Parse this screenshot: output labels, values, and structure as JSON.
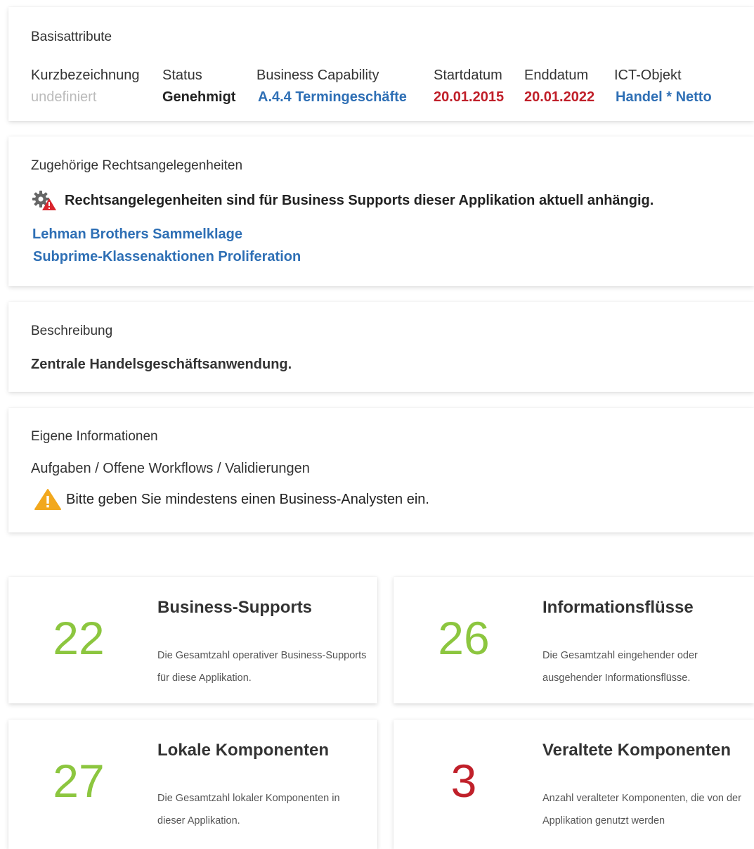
{
  "colors": {
    "link": "#2e6fb5",
    "date": "#c0202a",
    "count_green": "#8cc63f",
    "count_red": "#c0202a",
    "muted": "#bbbbbb"
  },
  "basis": {
    "title": "Basisattribute",
    "columns": [
      {
        "label": "Kurzbezeichnung",
        "value": "undefiniert"
      },
      {
        "label": "Status",
        "value": "Genehmigt"
      },
      {
        "label": "Business Capability",
        "value": "A.4.4 Termingeschäfte"
      },
      {
        "label": "Startdatum",
        "value": "20.01.2015"
      },
      {
        "label": "Enddatum",
        "value": "20.01.2022"
      },
      {
        "label": "ICT-Objekt",
        "value": "Handel * Netto"
      }
    ]
  },
  "legal": {
    "title": "Zugehörige Rechtsangelegenheiten",
    "notice": "Rechtsangelegenheiten sind für Business Supports dieser Applikation aktuell anhängig.",
    "notice_icon": "gear-warning-icon",
    "links": [
      "Lehman Brothers Sammelklage",
      "Subprime-Klassenaktionen Proliferation"
    ]
  },
  "description": {
    "title": "Beschreibung",
    "text": "Zentrale Handelsgeschäftsanwendung."
  },
  "own_info": {
    "title": "Eigene Informationen",
    "tasks_label": "Aufgaben / Offene Workflows / Validierungen",
    "warning": "Bitte geben Sie mindestens einen Business-Analysten ein.",
    "warning_icon": "warning-triangle-icon"
  },
  "tiles": [
    {
      "count": "22",
      "title": "Business-Supports",
      "description": "Die Gesamtzahl operativer Business-Supports für diese Applikation.",
      "color": "#8cc63f"
    },
    {
      "count": "26",
      "title": "Informationsflüsse",
      "description": "Die Gesamtzahl eingehender oder ausgehender Informationsflüsse.",
      "color": "#8cc63f"
    },
    {
      "count": "27",
      "title": "Lokale Komponenten",
      "description": "Die Gesamtzahl lokaler Komponenten in dieser Applikation.",
      "color": "#8cc63f"
    },
    {
      "count": "3",
      "title": "Veraltete Komponenten",
      "description": "Anzahl veralteter Komponenten, die von der Applikation genutzt werden",
      "color": "#c0202a"
    }
  ]
}
